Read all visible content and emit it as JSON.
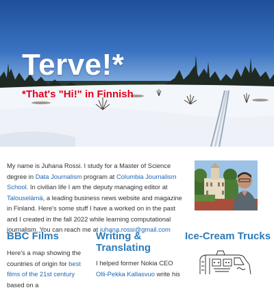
{
  "hero": {
    "title": "Terve!*",
    "subtitle": "*That's \"Hi!\" in Finnish"
  },
  "intro": {
    "t1": "My name is Juhana Rossi. I study for a Master of Science degree in ",
    "link1": "Data Journalism",
    "t2": " program at ",
    "link2": "Columbia Journalism School",
    "t3": ". In civilian life I am the deputy managing editor at ",
    "link3": "Talouselämä",
    "t4": ", a leading business news website and magazine in Finland. Here's some stuff I have a worked on in the past and I created in the fall 2022 while learning computational journalism. You can reach me at ",
    "email": "juhana.rossi@gmail.com"
  },
  "sections": {
    "bbc": {
      "title": "BBC Films",
      "t1": "Here's a map showing the countries of origin for ",
      "link1": "best films of the 21st century",
      "t2": " based on a"
    },
    "writing": {
      "title": "Writing & Translating",
      "t1": "I helped former Nokia CEO ",
      "link1": "Olli-Pekka Kallasvuo",
      "t2": " write his"
    },
    "icecream": {
      "title": "Ice-Cream Trucks"
    }
  },
  "colors": {
    "link": "#1f67b5",
    "heading": "#2c7bb8",
    "subtitle": "#e0001b"
  }
}
